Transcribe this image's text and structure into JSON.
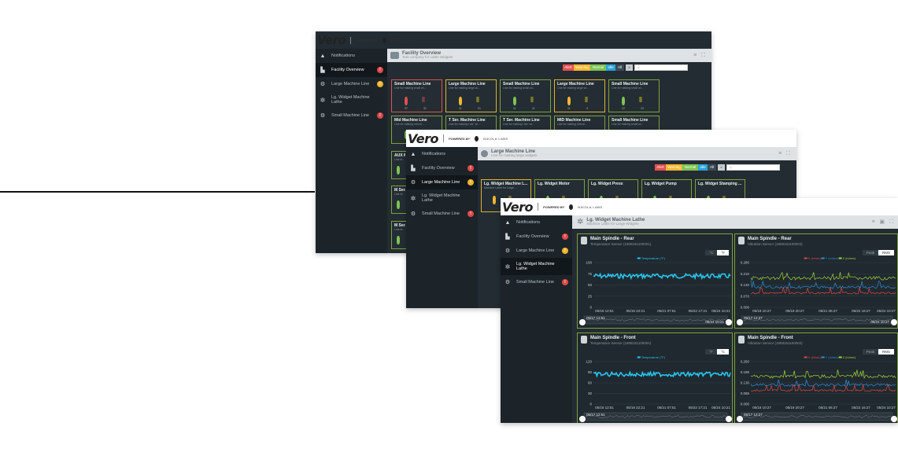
{
  "brand": {
    "logo": "Vero",
    "powered_by": "POWERED BY",
    "company": "NIKOLA LABS"
  },
  "nav": {
    "notifications": "Notifications",
    "facility_overview": "Facility Overview",
    "large_machine_line": "Large Machine Line",
    "lg_widget_machine_lathe": "Lg. Widget Machine Lathe",
    "small_machine_line": "Small Machine Line",
    "badge_facility": "!",
    "badge_large": "!",
    "badge_small": "!"
  },
  "win1": {
    "title": "Facility Overview",
    "subtitle": "Test company for Lathe Widgets",
    "filters": [
      "Alert",
      "Warning",
      "Normal",
      "Idle",
      "All"
    ],
    "filter_clear": "x",
    "search_placeholder": "?",
    "cards": [
      {
        "title": "Small Machine Line",
        "sub": "Line for making small wi...",
        "status": "alert",
        "v1": "37",
        "v2": "31"
      },
      {
        "title": "Large Machine Line",
        "sub": "Line for making large wi...",
        "status": "warn",
        "v1": "11",
        "v2": "21"
      },
      {
        "title": "Small Machine Line",
        "sub": "Line for making small wi...",
        "status": "normal",
        "v1": "11",
        "v2": "11"
      },
      {
        "title": "Large Machine Line",
        "sub": "Line for making large wi...",
        "status": "warn",
        "v1": "11",
        "v2": "9"
      },
      {
        "title": "Small Machine Line",
        "sub": "Line for making small wi...",
        "status": "normal",
        "v1": "22",
        "v2": "22"
      },
      {
        "title": "Mid Machine Line",
        "sub": "Line for making mid wi...",
        "status": "normal",
        "v1": "",
        "v2": ""
      },
      {
        "title": "T Ser. Machine Line",
        "sub": "Line for making t ser. wi...",
        "status": "normal",
        "v1": "",
        "v2": ""
      },
      {
        "title": "T Ser. Machine Line",
        "sub": "Line for making t ser. wi...",
        "status": "normal",
        "v1": "",
        "v2": ""
      },
      {
        "title": "MID Machine Line",
        "sub": "Line for making mid wi...",
        "status": "normal",
        "v1": "",
        "v2": ""
      },
      {
        "title": "Small Machine Line",
        "sub": "Line for making small wi...",
        "status": "normal",
        "v1": "",
        "v2": ""
      },
      {
        "title": "AUX M",
        "sub": "Line fo",
        "status": "normal"
      },
      {
        "title": "M Ser.",
        "sub": "Line fo",
        "status": "normal"
      },
      {
        "title": "M Ser.",
        "sub": "Line fo",
        "status": "normal"
      }
    ]
  },
  "win2": {
    "title": "Large Machine Line",
    "subtitle": "Line for making large widgets",
    "cards": [
      {
        "title": "Lg. Widget Machine L...",
        "sub": "Machine Lathe for Large ...",
        "status": "warn"
      },
      {
        "title": "Lg. Widget Motor",
        "sub": "",
        "status": "normal"
      },
      {
        "title": "Lg. Widget Press",
        "sub": "",
        "status": "normal"
      },
      {
        "title": "Lg. Widget Pump",
        "sub": "",
        "status": "normal"
      },
      {
        "title": "Lg. Widget Stamping ...",
        "sub": "",
        "status": "normal"
      }
    ]
  },
  "win3": {
    "title": "Lg. Widget Machine Lathe",
    "subtitle": "Machine Lathe for Large Widgets",
    "charts": [
      {
        "title": "Main Spindle - Rear",
        "sub": "Temperature Sensor (1908161100001)",
        "units": [
          "°C",
          "°F"
        ],
        "legend": [
          "Temperature (°F)"
        ],
        "yticks": [
          "100",
          "75",
          "50",
          "25",
          "0"
        ],
        "xticks": [
          "05/18 12:51",
          "05/19 22:21",
          "05/21 07:51",
          "05/22 17:21",
          "05/24 10:21"
        ],
        "range_start": "05/17 12:51",
        "range_end": "05/24 10:21"
      },
      {
        "title": "Main Spindle - Rear",
        "sub": "Vibration Sensor (1908161100003)",
        "units": [
          "Peak",
          "RMS"
        ],
        "legend": [
          "X (in/sec)",
          "Y (in/sec)",
          "Z (in/sec)"
        ],
        "yticks": [
          "0.280",
          "0.210",
          "0.140",
          "0.070",
          "0.000"
        ],
        "xticks": [
          "05/18 10:27",
          "05/19 20:27",
          "05/21 06:27",
          "05/22 16:27",
          "05/24 10:27"
        ],
        "range_start": "05/17 12:27",
        "range_end": "05/24 10:27"
      },
      {
        "title": "Main Spindle - Front",
        "sub": "Temperature Sensor (1908161100004)",
        "units": [
          "°F",
          "°C"
        ],
        "legend": [
          "Temperature (°F)"
        ],
        "yticks": [
          "120",
          "90",
          "60",
          "30",
          "0"
        ],
        "xticks": [
          "05/18 12:51",
          "05/19 22:21",
          "05/21 07:51",
          "05/22 17:21",
          "05/24 10:21"
        ],
        "range_start": "05/17 12:51",
        "range_end": ""
      },
      {
        "title": "Main Spindle - Front",
        "sub": "Vibration Sensor (1908161100004)",
        "units": [
          "Peak",
          "RMS"
        ],
        "legend": [
          "X (in/sec)",
          "Y (in/sec)",
          "Z (in/sec)"
        ],
        "yticks": [
          "0.260",
          "0.195",
          "0.130",
          "0.065",
          "0.000"
        ],
        "xticks": [
          "05/18 10:27",
          "05/19 20:27",
          "05/21 06:27",
          "05/22 16:27",
          "05/24 10:27"
        ],
        "range_start": "05/17 12:27",
        "range_end": ""
      }
    ]
  },
  "colors": {
    "alert": "#e05050",
    "warning": "#f5b731",
    "normal": "#7ec453",
    "idle": "#2aa3d8",
    "temperature_series": "#29c5f0",
    "x_series": "#e04848",
    "y_series": "#2a8fd8",
    "z_series": "#a6d23a"
  },
  "icons": {
    "notifications": "warning-triangle-icon",
    "facility": "factory-icon",
    "line": "gears-icon",
    "machine": "gear-icon",
    "temperature": "thermometer-icon",
    "vibration": "vibration-icon",
    "menu": "hamburger-icon",
    "fullscreen": "fullscreen-icon"
  }
}
